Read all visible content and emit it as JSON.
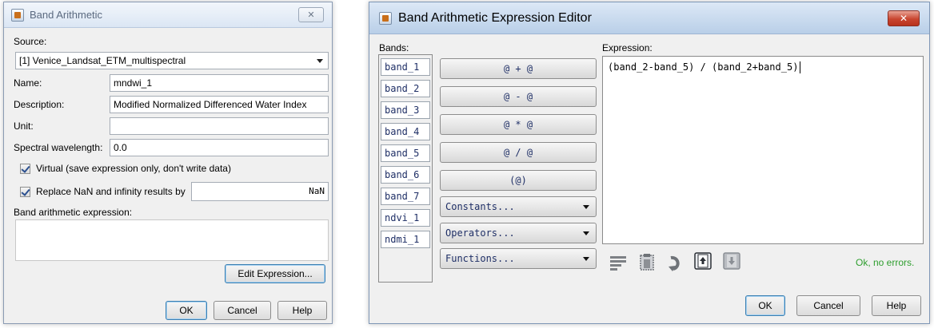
{
  "left_dialog": {
    "title": "Band Arithmetic",
    "close_glyph": "✕",
    "source_label": "Source:",
    "source_value": "[1] Venice_Landsat_ETM_multispectral",
    "name_label": "Name:",
    "name_value": "mndwi_1",
    "description_label": "Description:",
    "description_value": "Modified Normalized Differenced Water Index",
    "unit_label": "Unit:",
    "unit_value": "",
    "wavelength_label": "Spectral wavelength:",
    "wavelength_value": "0.0",
    "virtual_label": "Virtual (save expression only, don't write data)",
    "virtual_checked": true,
    "replace_nan_label": "Replace NaN and infinity results by",
    "replace_nan_checked": true,
    "replace_nan_value": "NaN",
    "expression_label": "Band arithmetic expression:",
    "expression_value": "",
    "edit_expression_button": "Edit Expression...",
    "ok_button": "OK",
    "cancel_button": "Cancel",
    "help_button": "Help"
  },
  "right_dialog": {
    "title": "Band Arithmetic Expression Editor",
    "close_glyph": "✕",
    "bands_label": "Bands:",
    "bands": [
      "band_1",
      "band_2",
      "band_3",
      "band_4",
      "band_5",
      "band_6",
      "band_7",
      "ndvi_1",
      "ndmi_1"
    ],
    "operator_buttons": [
      "@ + @",
      "@ - @",
      "@ * @",
      "@ / @",
      "(@)"
    ],
    "dropdowns": [
      "Constants...",
      "Operators...",
      "Functions..."
    ],
    "expression_label": "Expression:",
    "expression_value": "(band_2-band_5) / (band_2+band_5)",
    "status_text": "Ok, no errors.",
    "status_color": "#2e9e2e",
    "toolbar_icons": [
      "text-lines-icon",
      "clipboard-icon",
      "redo-icon",
      "load-icon",
      "save-icon"
    ],
    "ok_button": "OK",
    "cancel_button": "Cancel",
    "help_button": "Help"
  }
}
